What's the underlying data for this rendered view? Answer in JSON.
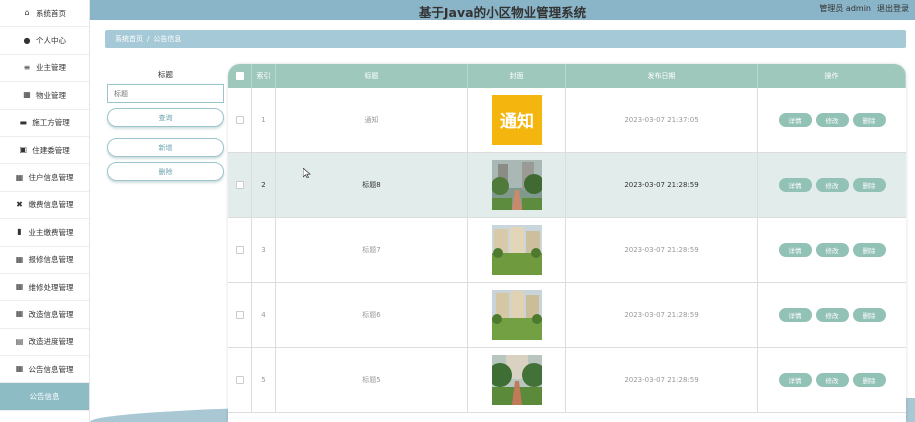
{
  "app": {
    "title": "基于Java的小区物业管理系统",
    "user_label": "管理员 admin",
    "logout_label": "退出登录"
  },
  "sidebar": {
    "items": [
      {
        "label": "系统首页",
        "icon": "home-icon",
        "glyph": "⌂"
      },
      {
        "label": "个人中心",
        "icon": "user-icon",
        "glyph": "●"
      },
      {
        "label": "业主管理",
        "icon": "list-icon",
        "glyph": "≡"
      },
      {
        "label": "物业管理",
        "icon": "grid-icon",
        "glyph": "▦"
      },
      {
        "label": "施工方管理",
        "icon": "chat-icon",
        "glyph": "▬"
      },
      {
        "label": "住建委管理",
        "icon": "clipboard-icon",
        "glyph": "▣"
      },
      {
        "label": "住户信息管理",
        "icon": "grid-icon",
        "glyph": "▦"
      },
      {
        "label": "缴费信息管理",
        "icon": "exchange-icon",
        "glyph": "✖"
      },
      {
        "label": "业主缴费管理",
        "icon": "bar-chart-icon",
        "glyph": "▮"
      },
      {
        "label": "报修信息管理",
        "icon": "grid-icon",
        "glyph": "▦"
      },
      {
        "label": "维修处理管理",
        "icon": "grid-icon",
        "glyph": "▦"
      },
      {
        "label": "改造信息管理",
        "icon": "grid-icon",
        "glyph": "▦"
      },
      {
        "label": "改造进度管理",
        "icon": "print-icon",
        "glyph": "▤"
      },
      {
        "label": "公告信息管理",
        "icon": "table-icon",
        "glyph": "▦"
      },
      {
        "label": "公告信息",
        "icon": "",
        "glyph": ""
      }
    ]
  },
  "breadcrumb": {
    "home": "系统首页",
    "separator": "/",
    "current": "公告信息"
  },
  "search": {
    "label": "标题",
    "placeholder": "标题",
    "query_label": "查询",
    "add_label": "新增",
    "delete_label": "删除"
  },
  "table": {
    "headers": {
      "index": "索引",
      "title": "标题",
      "cover": "封面",
      "date": "发布日期",
      "ops": "操作"
    },
    "rows": [
      {
        "index": "1",
        "title": "通知",
        "date": "2023-03-07 21:37:05",
        "cover": "notice"
      },
      {
        "index": "2",
        "title": "标题8",
        "date": "2023-03-07 21:28:59",
        "cover": "garden"
      },
      {
        "index": "3",
        "title": "标题7",
        "date": "2023-03-07 21:28:59",
        "cover": "lawn"
      },
      {
        "index": "4",
        "title": "标题6",
        "date": "2023-03-07 21:28:59",
        "cover": "lawn"
      },
      {
        "index": "5",
        "title": "标题5",
        "date": "2023-03-07 21:28:59",
        "cover": "path"
      }
    ],
    "op_labels": {
      "detail": "详情",
      "edit": "修改",
      "delete": "删除"
    },
    "notice_text": "通知"
  },
  "colors": {
    "header": "#8ab4c7",
    "table_head": "#9fc8bc",
    "accent": "#92c1b5",
    "active_item": "#8dbcc4"
  }
}
